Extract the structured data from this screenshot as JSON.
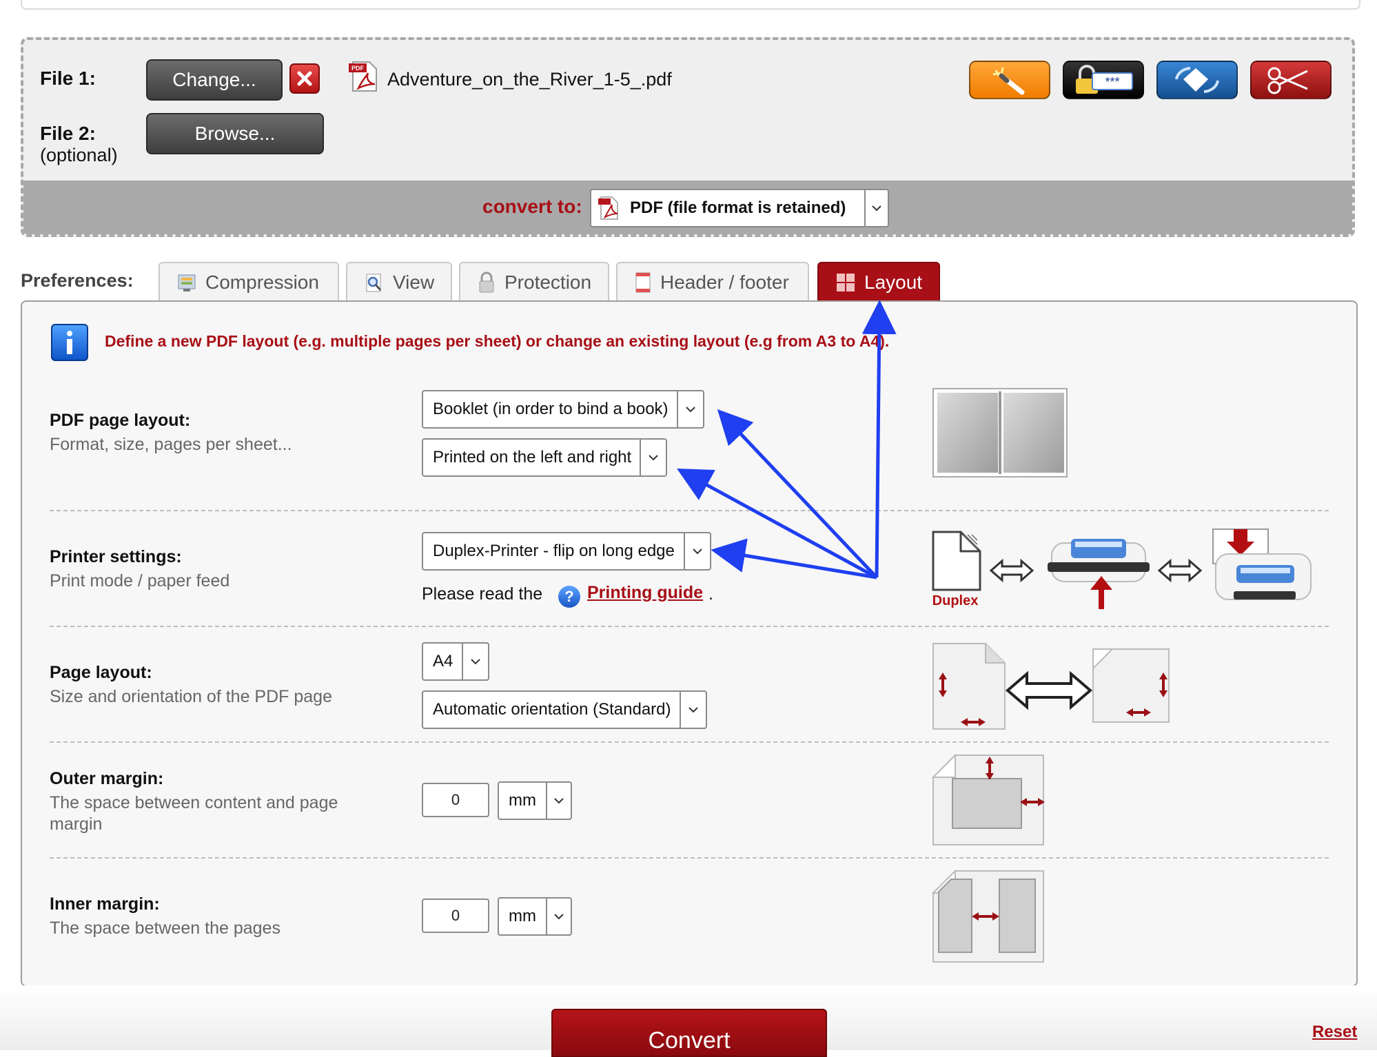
{
  "upload": {
    "file1_label": "File 1:",
    "file2_label": "File 2:",
    "file2_optional": "(optional)",
    "change_button": "Change...",
    "browse_button": "Browse...",
    "file_name": "Adventure_on_the_River_1-5_.pdf",
    "file_icon_text": "PDF"
  },
  "toolbar_icons": [
    "magic-wand-icon",
    "lock-password-icon",
    "rotate-page-icon",
    "scissors-icon"
  ],
  "convert": {
    "label": "convert to:",
    "format_value": "PDF (file format is retained)"
  },
  "preferences": {
    "label": "Preferences:",
    "tabs": [
      {
        "label": "Compression"
      },
      {
        "label": "View"
      },
      {
        "label": "Protection"
      },
      {
        "label": "Header / footer"
      },
      {
        "label": "Layout",
        "active": true
      }
    ]
  },
  "layout": {
    "info_text": "Define a new PDF layout (e.g. multiple pages per sheet) or change an existing layout (e.g from A3 to A4).",
    "pdf_page_layout": {
      "title": "PDF page layout:",
      "subtitle": "Format, size, pages per sheet...",
      "select1": "Booklet (in order to bind a book)",
      "select2": "Printed on the left and right"
    },
    "printer_settings": {
      "title": "Printer settings:",
      "subtitle": "Print mode / paper feed",
      "select": "Duplex-Printer - flip on long edge",
      "read_prefix": "Please read the",
      "guide_link": "Printing guide",
      "read_suffix": ".",
      "duplex_label": "Duplex"
    },
    "page_layout": {
      "title": "Page layout:",
      "subtitle": "Size and orientation of the PDF page",
      "size": "A4",
      "orientation": "Automatic orientation (Standard)"
    },
    "outer_margin": {
      "title": "Outer margin:",
      "subtitle": "The space between content and page margin",
      "value": "0",
      "unit": "mm"
    },
    "inner_margin": {
      "title": "Inner margin:",
      "subtitle": "The space between the pages",
      "value": "0",
      "unit": "mm"
    }
  },
  "actions": {
    "convert_button": "Convert",
    "reset_link": "Reset"
  },
  "colors": {
    "accent_red": "#a80f16",
    "annotation_blue": "#1f3ff0"
  }
}
